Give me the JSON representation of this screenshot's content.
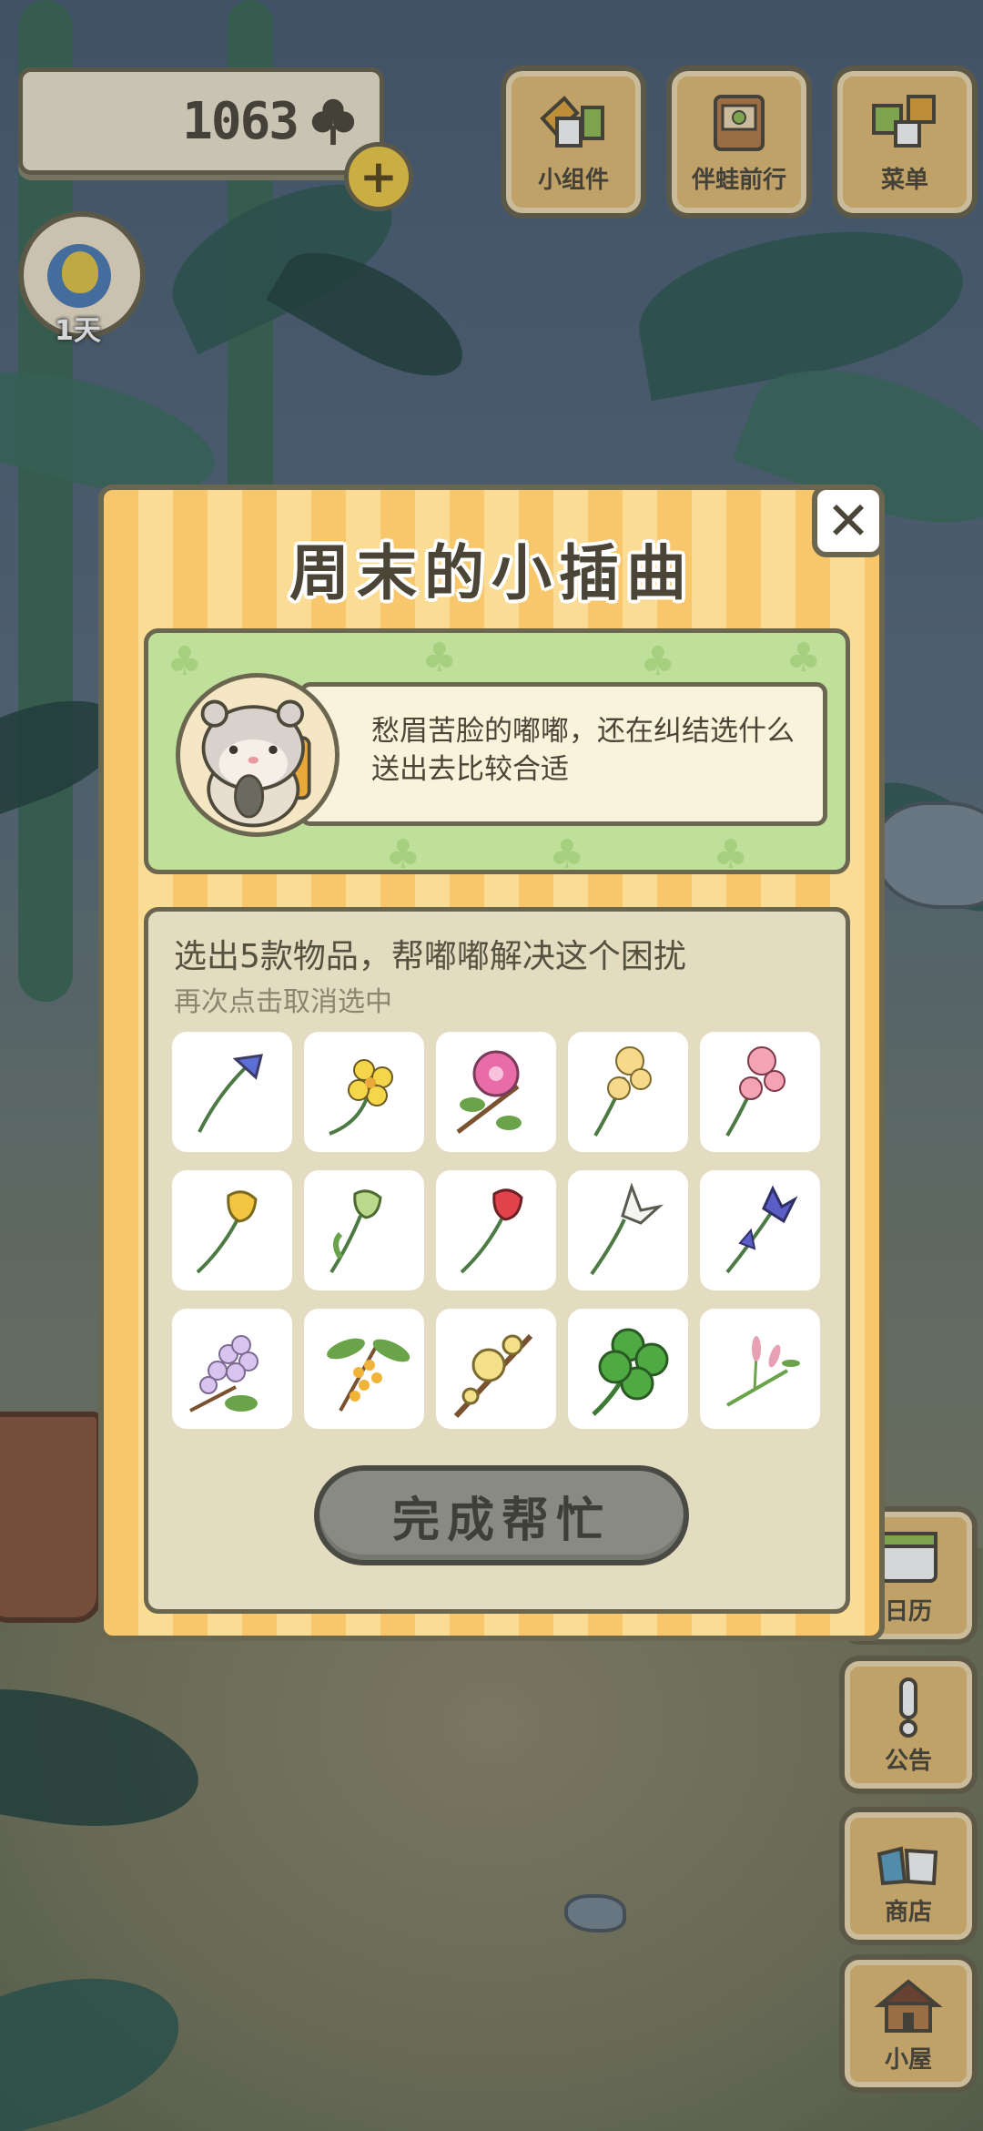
{
  "hud": {
    "currency": "1063",
    "currency_icon": "clover-icon",
    "plus_icon": "plus-icon",
    "avatar_day": "1天"
  },
  "top_buttons": [
    {
      "label": "小组件",
      "icon": "widget-icon"
    },
    {
      "label": "伴蛙前行",
      "icon": "frog-book-icon"
    },
    {
      "label": "菜单",
      "icon": "menu-cards-icon"
    }
  ],
  "side_buttons": [
    {
      "label": "日历",
      "icon": "calendar-icon"
    },
    {
      "label": "公告",
      "icon": "exclamation-icon"
    },
    {
      "label": "商店",
      "icon": "shop-bags-icon"
    },
    {
      "label": "小屋",
      "icon": "house-icon"
    }
  ],
  "dialog": {
    "title": "周末的小插曲",
    "close_icon": "close-icon",
    "story_text": "愁眉苦脸的嘟嘟，还在纠结选什么送出去比较合适",
    "select_title": "选出5款物品，帮嘟嘟解决这个困扰",
    "select_subtitle": "再次点击取消选中",
    "complete_button": "完成帮忙"
  },
  "items": [
    {
      "name": "bluebell-flower-icon",
      "color": "#5b6fd6"
    },
    {
      "name": "buttercup-flower-icon",
      "color": "#f5d54a"
    },
    {
      "name": "hibiscus-flower-icon",
      "color": "#e86ca8"
    },
    {
      "name": "pansy-yellow-flower-icon",
      "color": "#f6d98a"
    },
    {
      "name": "pansy-pink-flower-icon",
      "color": "#f3a3b3"
    },
    {
      "name": "yellow-tulip-flower-icon",
      "color": "#f3c542"
    },
    {
      "name": "green-tulip-flower-icon",
      "color": "#bcd88a"
    },
    {
      "name": "red-tulip-flower-icon",
      "color": "#e0434c"
    },
    {
      "name": "white-lily-flower-icon",
      "color": "#f4f4f0"
    },
    {
      "name": "iris-flower-icon",
      "color": "#5a5ec6"
    },
    {
      "name": "lilac-flower-icon",
      "color": "#d9c4ef"
    },
    {
      "name": "osmanthus-flower-icon",
      "color": "#f0b43a"
    },
    {
      "name": "wintersweet-flower-icon",
      "color": "#f5e08a"
    },
    {
      "name": "four-leaf-clover-icon",
      "color": "#4faa43"
    },
    {
      "name": "pink-grass-flower-icon",
      "color": "#e8a0b4"
    }
  ]
}
